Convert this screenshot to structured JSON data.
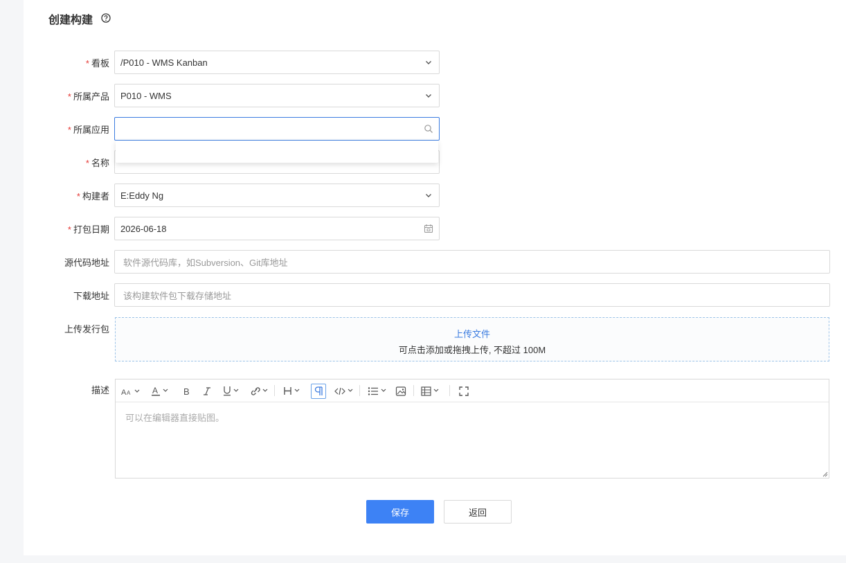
{
  "page": {
    "title": "创建构建"
  },
  "form": {
    "kanban": {
      "label": "看板",
      "value": "/P010 - WMS Kanban"
    },
    "product": {
      "label": "所属产品",
      "value": "P010 - WMS"
    },
    "app": {
      "label": "所属应用",
      "value": ""
    },
    "name": {
      "label": "名称",
      "value": ""
    },
    "builder": {
      "label": "构建者",
      "value": "E:Eddy Ng"
    },
    "pack_date": {
      "label": "打包日期",
      "value": "2026-06-18"
    },
    "source_repo": {
      "label": "源代码地址",
      "placeholder": "软件源代码库，如Subversion、Git库地址"
    },
    "download_url": {
      "label": "下载地址",
      "placeholder": "该构建软件包下载存储地址"
    },
    "upload": {
      "label": "上传发行包",
      "link": "上传文件",
      "hint": "可点击添加或拖拽上传, 不超过 100M"
    },
    "description": {
      "label": "描述",
      "placeholder": "可以在编辑器直接贴图。"
    },
    "required_mark": "*"
  },
  "toolbar": [
    "font-size-icon",
    "font-color-icon",
    "bold-icon",
    "italic-icon",
    "underline-icon",
    "link-icon",
    "heading-icon",
    "paragraph-icon",
    "code-icon",
    "list-icon",
    "image-icon",
    "table-icon",
    "fullscreen-icon"
  ],
  "actions": {
    "save": "保存",
    "back": "返回"
  },
  "colors": {
    "primary": "#3d82f5",
    "required": "#e53935",
    "link": "#3a7be0",
    "focus_border": "#3a7be0"
  }
}
